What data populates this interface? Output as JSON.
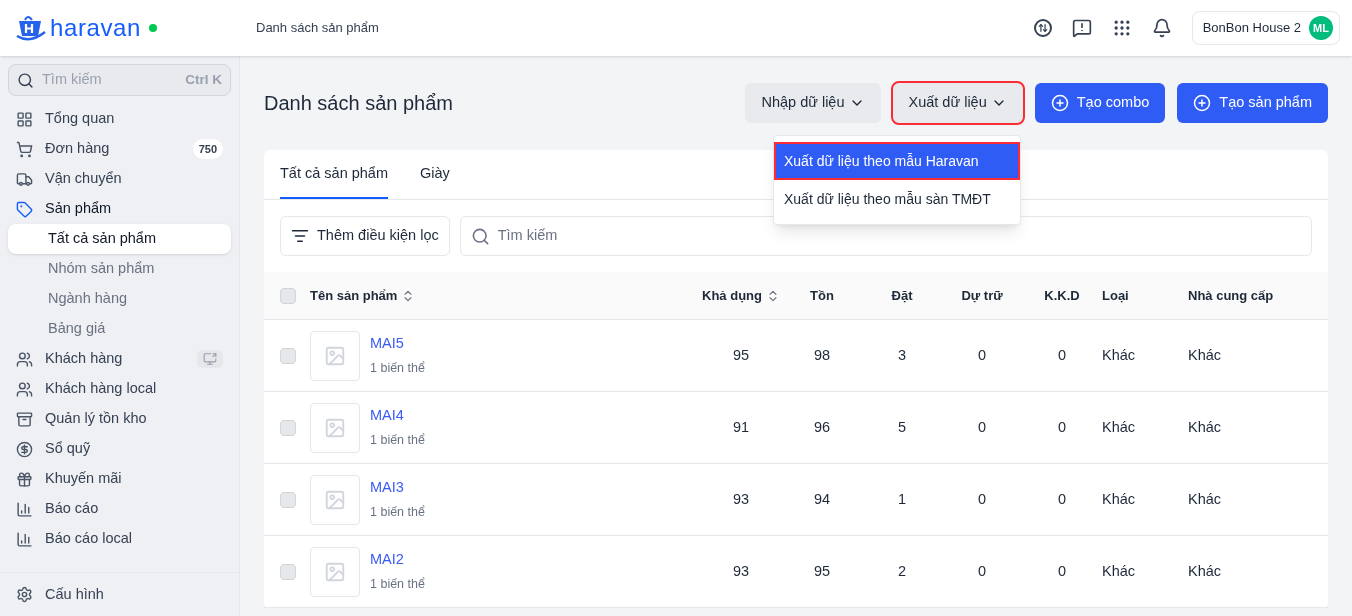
{
  "header": {
    "logo": "haravan",
    "online": true,
    "breadcrumb": "Danh sách sản phẩm",
    "store": "BonBon House 2",
    "avatar": "ML"
  },
  "sidebar": {
    "search": {
      "placeholder": "Tìm kiếm",
      "shortcut": "Ctrl K"
    },
    "items": [
      {
        "kind": "overview",
        "label": "Tổng quan",
        "selected": false
      },
      {
        "kind": "cart",
        "label": "Đơn hàng",
        "badge": "750",
        "selected": false
      },
      {
        "kind": "truck",
        "label": "Vận chuyển",
        "selected": false
      },
      {
        "kind": "tag",
        "label": "Sản phẩm",
        "selected": true,
        "expanded": true,
        "children": [
          {
            "label": "Tất cả sản phẩm",
            "selected": true
          },
          {
            "label": "Nhóm sản phẩm",
            "selected": false
          },
          {
            "label": "Ngành hàng",
            "selected": false
          },
          {
            "label": "Bảng giá",
            "selected": false
          }
        ]
      },
      {
        "kind": "users",
        "label": "Khách hàng",
        "action": true,
        "selected": false
      },
      {
        "kind": "users",
        "label": "Khách hàng local",
        "selected": false
      },
      {
        "kind": "archive",
        "label": "Quản lý tồn kho",
        "selected": false
      },
      {
        "kind": "dollar",
        "label": "Sổ quỹ",
        "selected": false
      },
      {
        "kind": "gift",
        "label": "Khuyến mãi",
        "selected": false
      },
      {
        "kind": "chart",
        "label": "Báo cáo",
        "selected": false
      },
      {
        "kind": "chart",
        "label": "Báo cáo local",
        "selected": false
      }
    ],
    "footer": {
      "label": "Cấu hình"
    }
  },
  "page": {
    "title": "Danh sách sản phẩm",
    "actions": [
      {
        "kind": "menu",
        "label": "Nhập dữ liệu",
        "highlighted": false
      },
      {
        "kind": "menu",
        "label": "Xuất dữ liệu",
        "highlighted": true
      },
      {
        "kind": "primary",
        "label": "Tạo combo",
        "highlighted": false
      },
      {
        "kind": "primary",
        "label": "Tạo sản phẩm",
        "highlighted": false
      }
    ],
    "export_menu": [
      {
        "label": "Xuất dữ liệu theo mẫu Haravan",
        "selected": true,
        "highlighted": true
      },
      {
        "label": "Xuất dữ liệu theo mẫu sàn TMĐT",
        "selected": false,
        "highlighted": false
      }
    ],
    "tabs": [
      {
        "label": "Tất cả sản phẩm",
        "selected": true
      },
      {
        "label": "Giày",
        "selected": false
      }
    ],
    "filter_button": "Thêm điều kiện lọc",
    "search": {
      "placeholder": "Tìm kiếm"
    },
    "table": {
      "columns": [
        {
          "label": "Tên sản phẩm",
          "sortable": true
        },
        {
          "label": "Khả dụng",
          "sortable": true
        },
        {
          "label": "Tồn",
          "sortable": false
        },
        {
          "label": "Đặt",
          "sortable": false
        },
        {
          "label": "Dự trữ",
          "sortable": false
        },
        {
          "label": "K.K.D",
          "sortable": false
        },
        {
          "label": "Loại",
          "sortable": false
        },
        {
          "label": "Nhà cung cấp",
          "sortable": false
        }
      ],
      "select_all_checked": false,
      "rows": [
        {
          "checked": false,
          "variants": "1 biến thể",
          "cells": [
            "MAI5",
            "95",
            "98",
            "3",
            "0",
            "0",
            "Khác",
            "Khác"
          ]
        },
        {
          "checked": false,
          "variants": "1 biến thể",
          "cells": [
            "MAI4",
            "91",
            "96",
            "5",
            "0",
            "0",
            "Khác",
            "Khác"
          ]
        },
        {
          "checked": false,
          "variants": "1 biến thể",
          "cells": [
            "MAI3",
            "93",
            "94",
            "1",
            "0",
            "0",
            "Khác",
            "Khác"
          ]
        },
        {
          "checked": false,
          "variants": "1 biến thể",
          "cells": [
            "MAI2",
            "93",
            "95",
            "2",
            "0",
            "0",
            "Khác",
            "Khác"
          ]
        }
      ]
    }
  }
}
